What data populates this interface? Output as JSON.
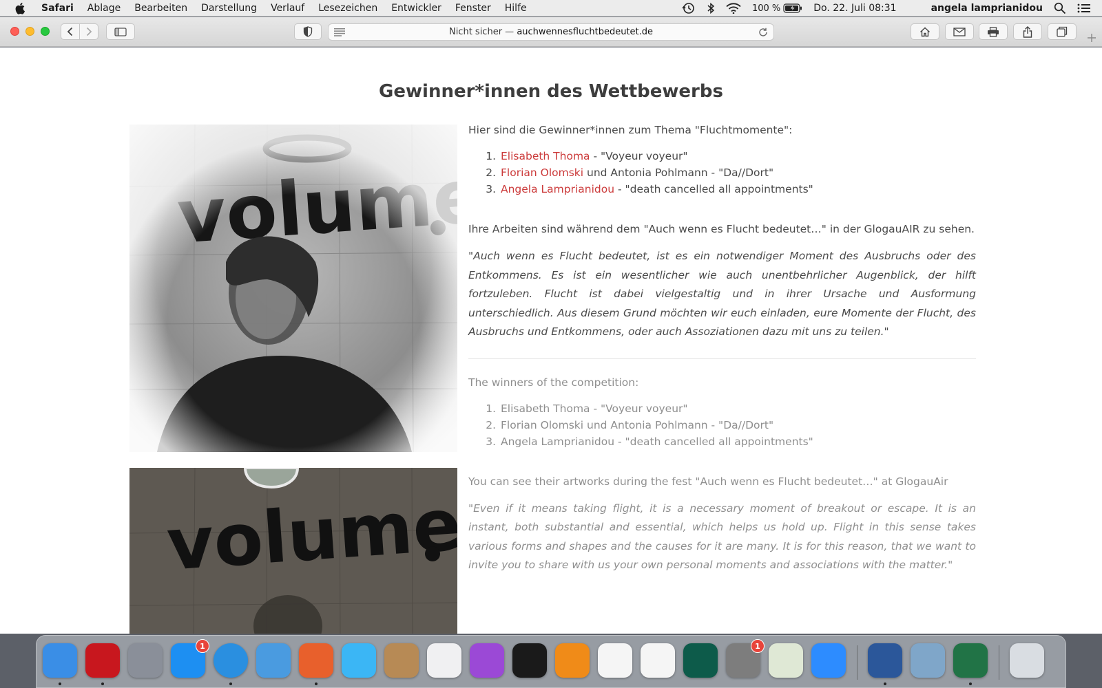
{
  "menubar": {
    "app_name": "Safari",
    "items": [
      "Ablage",
      "Bearbeiten",
      "Darstellung",
      "Verlauf",
      "Lesezeichen",
      "Entwickler",
      "Fenster",
      "Hilfe"
    ],
    "battery": "100 %",
    "datetime": "Do. 22. Juli  08:31",
    "user": "angela lamprianidou"
  },
  "toolbar": {
    "address_prefix": "Nicht sicher — ",
    "address_domain": "auchwennesfluchtbedeutet.de"
  },
  "page": {
    "title": "Gewinner*innen des Wettbewerbs",
    "de": {
      "intro": "Hier sind die Gewinner*innen zum Thema \"Fluchtmomente\":",
      "winners": [
        {
          "name": "Elisabeth Thoma",
          "rest": " - \"Voyeur voyeur\""
        },
        {
          "name": "Florian Olomski",
          "rest": " und Antonia Pohlmann - \"Da//Dort\""
        },
        {
          "name": "Angela Lamprianidou",
          "rest": " - \"death cancelled all appointments\""
        }
      ],
      "exhibit": "Ihre Arbeiten sind während dem \"Auch wenn es Flucht bedeutet…\" in der GlogauAIR zu sehen.",
      "quote": "\"Auch wenn es Flucht bedeutet, ist es ein notwendiger Moment des Ausbruchs oder des Entkommens. Es ist ein wesentlicher wie auch unentbehrlicher Augenblick, der hilft fortzuleben. Flucht ist dabei vielgestaltig und in ihrer Ursache und Ausformung unterschiedlich. Aus diesem Grund möchten wir euch einladen, eure Momente der Flucht, des Ausbruchs und Entkommens, oder auch Assoziationen dazu mit uns zu teilen.\""
    },
    "en": {
      "intro": "The winners of the competition:",
      "winners": [
        "Elisabeth Thoma - \"Voyeur voyeur\"",
        "Florian Olomski und Antonia Pohlmann - \"Da//Dort\"",
        "Angela Lamprianidou - \"death cancelled all appointments\""
      ],
      "exhibit": "You can see their artworks during the fest \"Auch wenn es Flucht bedeutet…\" at GlogauAir",
      "quote": "\"Even if it means taking flight, it is a necessary moment of breakout or escape. It is an instant, both substantial and essential, which helps us hold up. Flight in this sense takes various forms and shapes and the causes for it are many. It is for this reason, that we want to invite you to share with us your own personal moments and associations with the matter.\""
    },
    "photo_graffiti_text": "volume"
  },
  "dock": {
    "apps": [
      {
        "name": "finder-icon",
        "color": "#3a8ee6",
        "running": true
      },
      {
        "name": "acrobat-icon",
        "color": "#c8171e",
        "running": true
      },
      {
        "name": "launchpad-icon",
        "color": "#8a8f99",
        "running": false
      },
      {
        "name": "app-store-icon",
        "color": "#1d8ff2",
        "running": false,
        "badge": "1"
      },
      {
        "name": "safari-icon",
        "color": "#2a8fe0",
        "running": true
      },
      {
        "name": "mail-icon",
        "color": "#4a9be0",
        "running": false
      },
      {
        "name": "firefox-icon",
        "color": "#e8602c",
        "running": true
      },
      {
        "name": "messages-icon",
        "color": "#3bb6f5",
        "running": false
      },
      {
        "name": "contacts-icon",
        "color": "#b78a55",
        "running": false
      },
      {
        "name": "music-icon",
        "color": "#f0f0f2",
        "running": false
      },
      {
        "name": "podcasts-icon",
        "color": "#9b49d6",
        "running": false
      },
      {
        "name": "tv-icon",
        "color": "#1a1a1a",
        "running": false
      },
      {
        "name": "books-icon",
        "color": "#f08b18",
        "running": false
      },
      {
        "name": "imovie-icon",
        "color": "#f5f5f5",
        "running": false
      },
      {
        "name": "photos-icon",
        "color": "#f5f5f5",
        "running": false
      },
      {
        "name": "time-machine-icon",
        "color": "#0d5b4a",
        "running": false
      },
      {
        "name": "system-preferences-icon",
        "color": "#7d7d7d",
        "running": false,
        "badge": "1"
      },
      {
        "name": "maps-icon",
        "color": "#dfe8d5",
        "running": false
      },
      {
        "name": "zoom-icon",
        "color": "#2d8cff",
        "running": false
      },
      {
        "name": "word-icon",
        "color": "#2b579a",
        "running": true
      },
      {
        "name": "preview-icon",
        "color": "#7fa6c9",
        "running": false
      },
      {
        "name": "excel-icon",
        "color": "#217346",
        "running": true
      },
      {
        "name": "trash-icon",
        "color": "#d9dde2",
        "running": false
      }
    ]
  }
}
